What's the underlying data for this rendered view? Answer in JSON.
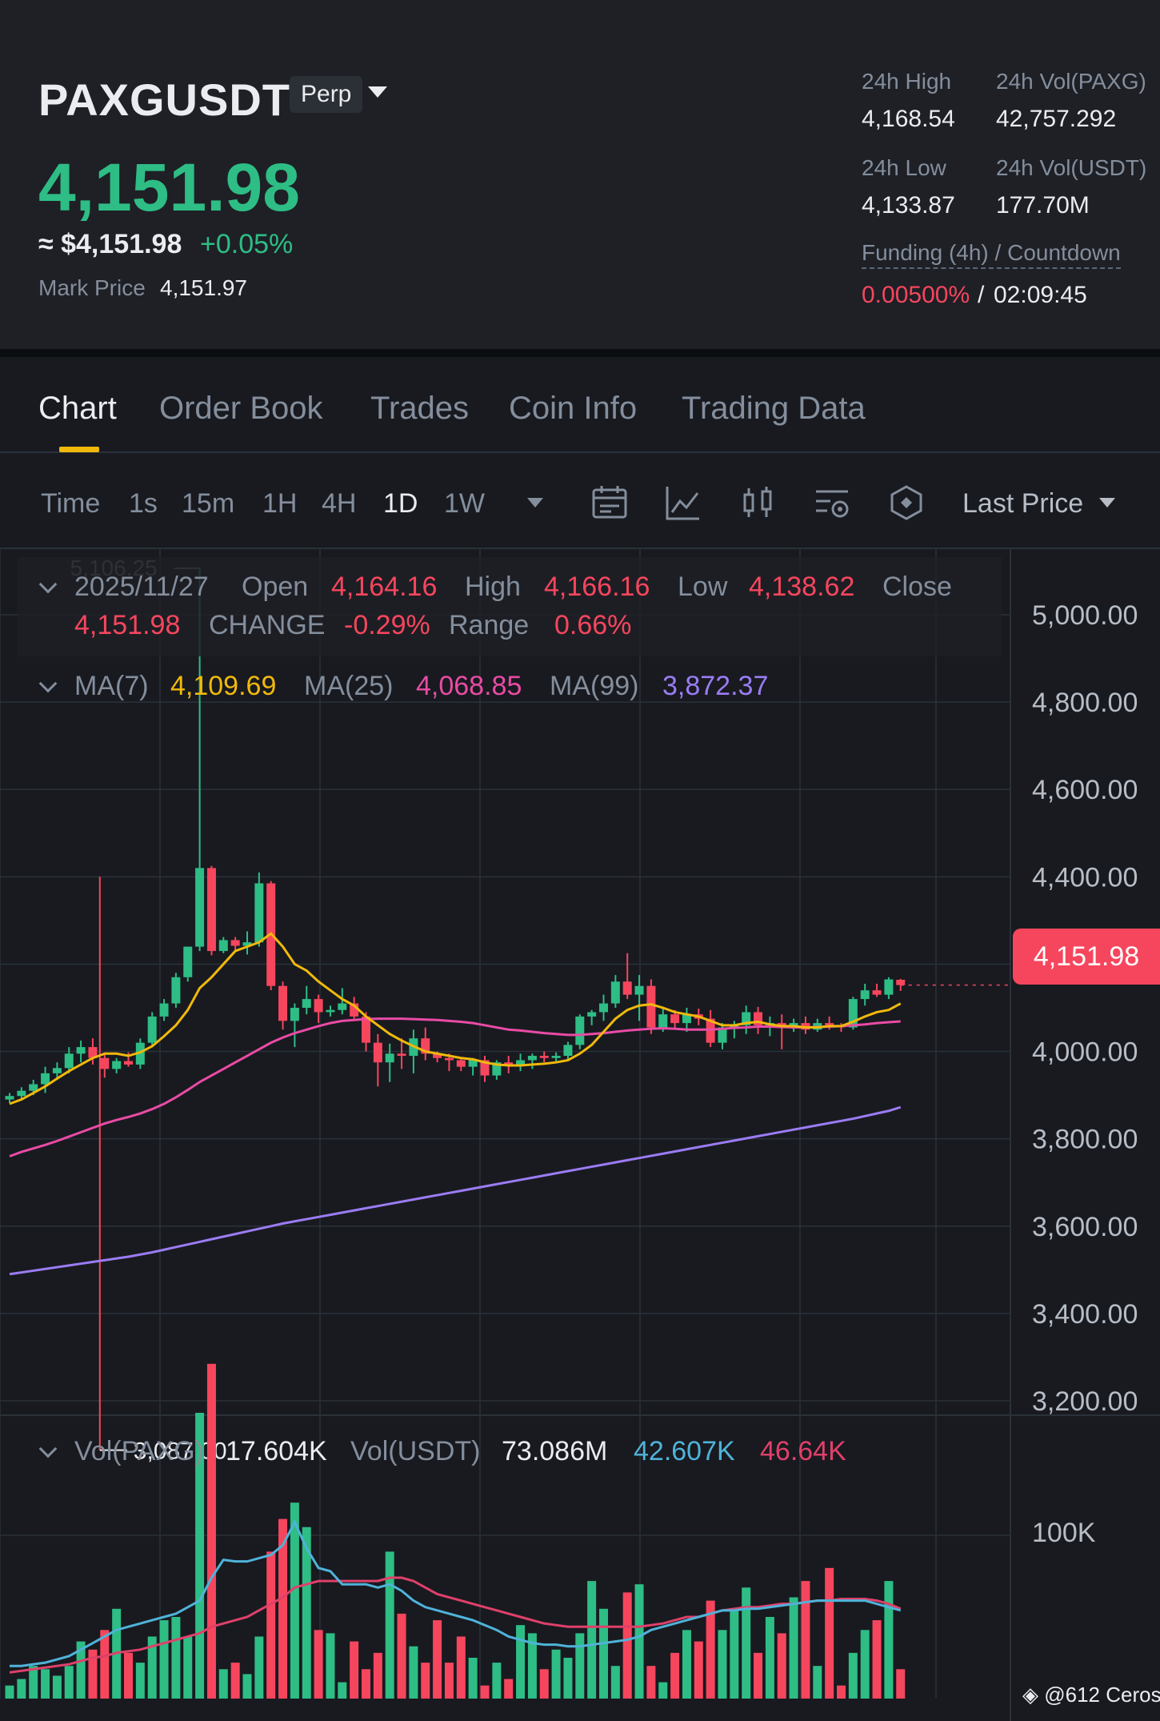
{
  "header": {
    "symbol": "PAXGUSDT",
    "contract_type": "Perp",
    "last_price": "4,151.98",
    "usd_price": "≈ $4,151.98",
    "change_pct": "+0.05%",
    "mark_price_label": "Mark Price",
    "mark_price": "4,151.97",
    "stats": {
      "high_label": "24h High",
      "high": "4,168.54",
      "vol_base_label": "24h Vol(PAXG)",
      "vol_base": "42,757.292",
      "low_label": "24h Low",
      "low": "4,133.87",
      "vol_quote_label": "24h Vol(USDT)",
      "vol_quote": "177.70M",
      "funding_label": "Funding (4h) / Countdown",
      "funding_rate": "0.00500%",
      "funding_sep": "/",
      "countdown": "02:09:45"
    }
  },
  "tabs": [
    "Chart",
    "Order Book",
    "Trades",
    "Coin Info",
    "Trading Data"
  ],
  "toolbar": {
    "intervals": [
      "Time",
      "1s",
      "15m",
      "1H",
      "4H",
      "1D",
      "1W"
    ],
    "active_interval": "1D",
    "price_type": "Last Price",
    "icons": [
      "calendar-icon",
      "indicator-icon",
      "candle-type-icon",
      "chart-settings-icon",
      "depth-icon"
    ]
  },
  "ohlc": {
    "date": "2025/11/27",
    "open_label": "Open",
    "open": "4,164.16",
    "high_label": "High",
    "high": "4,166.16",
    "low_label": "Low",
    "low": "4,138.62",
    "close_label": "Close",
    "close": "4,151.98",
    "change_label": "CHANGE",
    "change": "-0.29%",
    "range_label": "Range",
    "range": "0.66%"
  },
  "ma": {
    "ma7_label": "MA(7)",
    "ma7": "4,109.69",
    "ma25_label": "MA(25)",
    "ma25": "4,068.85",
    "ma99_label": "MA(99)",
    "ma99": "3,872.37"
  },
  "volume": {
    "base_label": "Vol(PAXG)",
    "base": "17.604K",
    "quote_label": "Vol(USDT)",
    "quote": "73.086M",
    "ma_a": "42.607K",
    "ma_b": "46.64K",
    "axis_label": "100K"
  },
  "colors": {
    "up": "#2ebd85",
    "down": "#f6465d",
    "ma7": "#f0b90b",
    "ma25": "#e94ba4",
    "ma99": "#9b7cf4",
    "vol_ma_a": "#4fb3d9",
    "vol_ma_b": "#e0406a",
    "accent": "#f0b90b"
  },
  "chart_data": {
    "type": "candlestick",
    "y_ticks": [
      "5,000.00",
      "4,800.00",
      "4,600.00",
      "4,400.00",
      "4,000.00",
      "3,800.00",
      "3,600.00",
      "3,400.00",
      "3,200.00"
    ],
    "ylim": [
      3087,
      5106.25
    ],
    "max_marker": "5,106.25",
    "min_marker": "3,087.00",
    "last_price_label": "4,151.98",
    "candles": [
      [
        3890,
        3905,
        3882,
        3898
      ],
      [
        3898,
        3918,
        3888,
        3910
      ],
      [
        3910,
        3935,
        3900,
        3925
      ],
      [
        3925,
        3965,
        3905,
        3950
      ],
      [
        3950,
        3975,
        3935,
        3962
      ],
      [
        3962,
        4010,
        3950,
        3995
      ],
      [
        3995,
        4025,
        3975,
        4010
      ],
      [
        4010,
        4030,
        3970,
        3985
      ],
      [
        3985,
        3995,
        3940,
        3960
      ],
      [
        3960,
        3985,
        3950,
        3978
      ],
      [
        3978,
        3998,
        3965,
        3970
      ],
      [
        3970,
        4030,
        3960,
        4020
      ],
      [
        4020,
        4090,
        4015,
        4080
      ],
      [
        4080,
        4120,
        4070,
        4110
      ],
      [
        4110,
        4180,
        4100,
        4170
      ],
      [
        4170,
        4230,
        4160,
        4240
      ],
      [
        4240,
        5106.25,
        4230,
        4420
      ],
      [
        4420,
        4425,
        4220,
        4230
      ],
      [
        4230,
        4262,
        4225,
        4255
      ],
      [
        4255,
        4262,
        4230,
        4242
      ],
      [
        4242,
        4275,
        4222,
        4250
      ],
      [
        4250,
        4410,
        4240,
        4385
      ],
      [
        4385,
        4390,
        4140,
        4150
      ],
      [
        4150,
        4160,
        4050,
        4070
      ],
      [
        4070,
        4110,
        4010,
        4100
      ],
      [
        4100,
        4150,
        4085,
        4120
      ],
      [
        4120,
        4130,
        4065,
        4090
      ],
      [
        4090,
        4105,
        4080,
        4095
      ],
      [
        4095,
        4145,
        4085,
        4110
      ],
      [
        4110,
        4125,
        4075,
        4080
      ],
      [
        4080,
        4090,
        4000,
        4020
      ],
      [
        4020,
        4040,
        3920,
        3975
      ],
      [
        3975,
        4018,
        3930,
        3995
      ],
      [
        3995,
        4030,
        3960,
        3990
      ],
      [
        3990,
        4050,
        3950,
        4030
      ],
      [
        4030,
        4055,
        3980,
        3995
      ],
      [
        3995,
        4000,
        3975,
        3985
      ],
      [
        3985,
        3995,
        3955,
        3980
      ],
      [
        3980,
        3985,
        3955,
        3965
      ],
      [
        3965,
        3985,
        3945,
        3980
      ],
      [
        3980,
        3990,
        3930,
        3945
      ],
      [
        3945,
        3980,
        3935,
        3975
      ],
      [
        3975,
        3990,
        3950,
        3968
      ],
      [
        3968,
        3995,
        3955,
        3980
      ],
      [
        3980,
        3995,
        3960,
        3990
      ],
      [
        3990,
        4000,
        3975,
        3985
      ],
      [
        3985,
        3998,
        3975,
        3990
      ],
      [
        3990,
        4022,
        3980,
        4015
      ],
      [
        4015,
        4085,
        4005,
        4080
      ],
      [
        4080,
        4095,
        4060,
        4090
      ],
      [
        4090,
        4130,
        4070,
        4110
      ],
      [
        4110,
        4175,
        4100,
        4160
      ],
      [
        4160,
        4225,
        4120,
        4130
      ],
      [
        4130,
        4175,
        4070,
        4150
      ],
      [
        4150,
        4165,
        4040,
        4055
      ],
      [
        4055,
        4100,
        4045,
        4085
      ],
      [
        4085,
        4095,
        4050,
        4065
      ],
      [
        4065,
        4100,
        4045,
        4085
      ],
      [
        4085,
        4098,
        4060,
        4075
      ],
      [
        4075,
        4095,
        4010,
        4020
      ],
      [
        4020,
        4065,
        4005,
        4055
      ],
      [
        4055,
        4070,
        4030,
        4060
      ],
      [
        4060,
        4105,
        4040,
        4090
      ],
      [
        4090,
        4102,
        4040,
        4060
      ],
      [
        4060,
        4080,
        4035,
        4065
      ],
      [
        4065,
        4085,
        4005,
        4055
      ],
      [
        4055,
        4075,
        4045,
        4065
      ],
      [
        4065,
        4080,
        4040,
        4050
      ],
      [
        4050,
        4075,
        4045,
        4065
      ],
      [
        4065,
        4080,
        4050,
        4060
      ],
      [
        4060,
        4065,
        4045,
        4055
      ],
      [
        4055,
        4125,
        4050,
        4120
      ],
      [
        4120,
        4155,
        4105,
        4140
      ],
      [
        4140,
        4155,
        4125,
        4130
      ],
      [
        4130,
        4170,
        4120,
        4165
      ],
      [
        4164.16,
        4166.16,
        4138.62,
        4151.98
      ]
    ],
    "ma7": [
      3880,
      3890,
      3905,
      3920,
      3938,
      3955,
      3970,
      3985,
      3995,
      3995,
      3990,
      3998,
      4012,
      4035,
      4060,
      4095,
      4145,
      4170,
      4200,
      4230,
      4240,
      4250,
      4270,
      4240,
      4200,
      4185,
      4160,
      4140,
      4120,
      4105,
      4080,
      4060,
      4040,
      4025,
      4012,
      4000,
      3995,
      3990,
      3985,
      3982,
      3975,
      3970,
      3968,
      3968,
      3970,
      3972,
      3975,
      3980,
      3995,
      4015,
      4045,
      4075,
      4095,
      4105,
      4108,
      4100,
      4090,
      4085,
      4080,
      4070,
      4060,
      4060,
      4065,
      4068,
      4062,
      4058,
      4058,
      4055,
      4055,
      4058,
      4058,
      4068,
      4080,
      4090,
      4095,
      4109.69
    ],
    "ma25": [
      3760,
      3770,
      3778,
      3786,
      3795,
      3805,
      3815,
      3825,
      3835,
      3843,
      3850,
      3858,
      3868,
      3880,
      3895,
      3912,
      3930,
      3945,
      3960,
      3975,
      3990,
      4005,
      4020,
      4032,
      4042,
      4050,
      4058,
      4065,
      4070,
      4072,
      4074,
      4075,
      4075,
      4075,
      4074,
      4073,
      4072,
      4070,
      4068,
      4065,
      4060,
      4055,
      4050,
      4048,
      4045,
      4042,
      4040,
      4038,
      4038,
      4040,
      4042,
      4045,
      4048,
      4050,
      4052,
      4053,
      4052,
      4050,
      4050,
      4050,
      4052,
      4054,
      4055,
      4057,
      4057,
      4056,
      4055,
      4055,
      4056,
      4057,
      4058,
      4060,
      4062,
      4065,
      4067,
      4068.85
    ],
    "ma99": [
      3490,
      3494,
      3498,
      3502,
      3506,
      3510,
      3514,
      3518,
      3522,
      3526,
      3530,
      3535,
      3540,
      3546,
      3552,
      3558,
      3564,
      3570,
      3576,
      3582,
      3588,
      3594,
      3600,
      3606,
      3611,
      3616,
      3621,
      3626,
      3631,
      3636,
      3641,
      3646,
      3651,
      3656,
      3661,
      3666,
      3671,
      3676,
      3681,
      3686,
      3691,
      3696,
      3701,
      3706,
      3711,
      3716,
      3721,
      3726,
      3731,
      3736,
      3741,
      3746,
      3751,
      3756,
      3761,
      3766,
      3771,
      3776,
      3781,
      3786,
      3791,
      3796,
      3801,
      3806,
      3811,
      3816,
      3821,
      3826,
      3831,
      3836,
      3841,
      3846,
      3852,
      3858,
      3864,
      3872.37
    ],
    "volumes": [
      8,
      12,
      20,
      18,
      14,
      20,
      35,
      30,
      42,
      55,
      28,
      22,
      38,
      48,
      50,
      38,
      175,
      205,
      18,
      22,
      15,
      38,
      90,
      110,
      120,
      105,
      42,
      40,
      10,
      35,
      18,
      28,
      90,
      52,
      32,
      22,
      48,
      22,
      38,
      25,
      8,
      22,
      12,
      45,
      40,
      18,
      30,
      25,
      40,
      72,
      55,
      20,
      65,
      70,
      20,
      10,
      28,
      42,
      35,
      60,
      42,
      55,
      68,
      28,
      50,
      40,
      62,
      72,
      20,
      80,
      8,
      28,
      42,
      48,
      72,
      18
    ],
    "vol_ma_a": [
      20,
      20,
      21,
      22,
      24,
      26,
      30,
      34,
      38,
      42,
      44,
      46,
      48,
      50,
      52,
      56,
      60,
      74,
      85,
      84,
      84,
      86,
      88,
      94,
      108,
      92,
      80,
      78,
      70,
      70,
      70,
      68,
      70,
      66,
      60,
      56,
      54,
      52,
      50,
      48,
      45,
      42,
      38,
      36,
      34,
      33,
      33,
      32,
      32,
      33,
      34,
      35,
      36,
      38,
      42,
      44,
      46,
      48,
      50,
      52,
      54,
      54,
      55,
      55,
      56,
      57,
      58,
      59,
      60,
      60,
      60,
      60,
      60,
      58,
      56,
      54
    ],
    "vol_ma_b": [
      16,
      17,
      18,
      19,
      20,
      21,
      23,
      25,
      26,
      28,
      29,
      30,
      32,
      34,
      36,
      38,
      40,
      44,
      46,
      48,
      50,
      54,
      58,
      62,
      68,
      70,
      72,
      72,
      72,
      72,
      72,
      72,
      74,
      74,
      72,
      68,
      64,
      62,
      60,
      58,
      56,
      54,
      52,
      50,
      48,
      46,
      45,
      44,
      44,
      44,
      44,
      44,
      44,
      44,
      45,
      46,
      48,
      50,
      50,
      52,
      54,
      55,
      56,
      56,
      57,
      58,
      58,
      59,
      60,
      60,
      61,
      61,
      61,
      60,
      58,
      55
    ],
    "vol_axis_tick": "100K"
  },
  "footer": {
    "watermark": "@612 Ceros"
  }
}
